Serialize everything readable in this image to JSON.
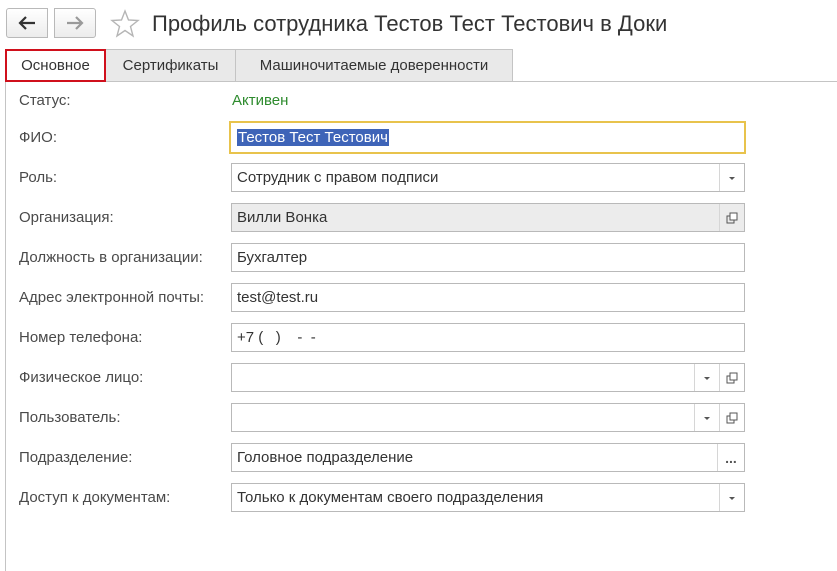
{
  "window": {
    "title": "Профиль сотрудника Тестов Тест Тестович в Доки"
  },
  "tabs": [
    {
      "label": "Основное",
      "active": true
    },
    {
      "label": "Сертификаты",
      "active": false
    },
    {
      "label": "Машиночитаемые доверенности",
      "active": false
    }
  ],
  "form": {
    "status": {
      "label": "Статус:",
      "value": "Активен"
    },
    "fio": {
      "label": "ФИО:",
      "value": "Тестов Тест Тестович"
    },
    "role": {
      "label": "Роль:",
      "value": "Сотрудник с правом подписи"
    },
    "organization": {
      "label": "Организация:",
      "value": "Вилли Вонка"
    },
    "position": {
      "label": "Должность в организации:",
      "value": "Бухгалтер"
    },
    "email": {
      "label": "Адрес электронной почты:",
      "value": "test@test.ru"
    },
    "phone": {
      "label": "Номер телефона:",
      "value": "+7 (   )    -  -"
    },
    "person": {
      "label": "Физическое лицо:",
      "value": ""
    },
    "user": {
      "label": "Пользователь:",
      "value": ""
    },
    "department": {
      "label": "Подразделение:",
      "value": "Головное подразделение",
      "button": "..."
    },
    "access": {
      "label": "Доступ к документам:",
      "value": "Только к документам своего подразделения"
    }
  },
  "colors": {
    "status_active": "#2e8b2e",
    "tab_highlight": "#d0101c",
    "focus_border": "#e8c34c",
    "selection": "#3e64b8"
  }
}
